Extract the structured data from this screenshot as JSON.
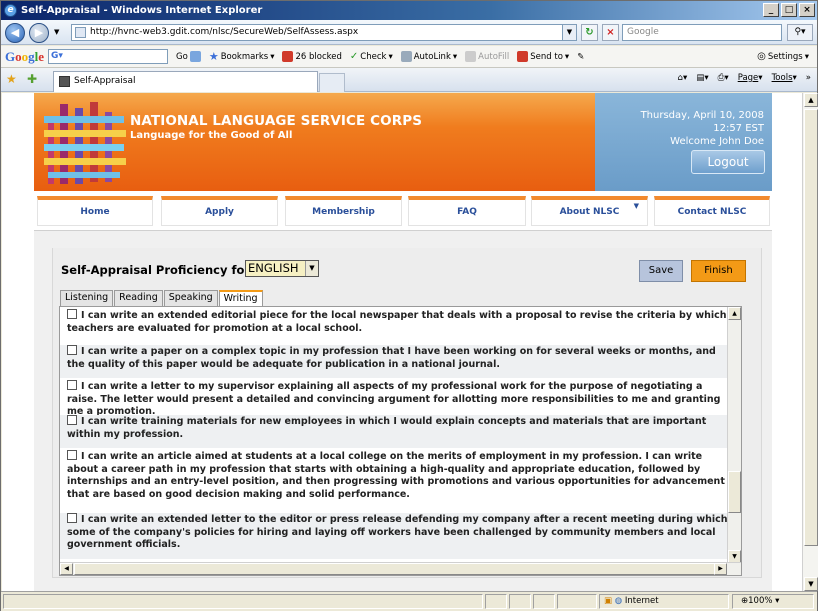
{
  "browser": {
    "title": "Self-Appraisal - Windows Internet Explorer",
    "url": "http://hvnc-web3.gdit.com/nlsc/SecureWeb/SelfAssess.aspx",
    "search_placeholder": "Google",
    "tab_title": "Self-Appraisal",
    "google_toolbar": {
      "go": "Go",
      "bookmarks": "Bookmarks",
      "blocked": "26 blocked",
      "check": "Check",
      "autolink": "AutoLink",
      "autofill": "AutoFill",
      "sendto": "Send to",
      "settings": "Settings"
    },
    "commands": {
      "page": "Page",
      "tools": "Tools"
    },
    "status": {
      "zone": "Internet",
      "zoom": "100%"
    }
  },
  "site": {
    "org_name": "NATIONAL LANGUAGE SERVICE CORPS",
    "tagline": "Language for the Good of All",
    "date": "Thursday, April 10, 2008",
    "time": "12:57 EST",
    "welcome": "Welcome John Doe",
    "logout": "Logout",
    "nav": [
      "Home",
      "Apply",
      "Membership",
      "FAQ",
      "About NLSC",
      "Contact NLSC"
    ]
  },
  "form": {
    "title": "Self-Appraisal Proficiency for:",
    "language": "ENGLISH",
    "save": "Save",
    "finish": "Finish",
    "tabs": [
      "Listening",
      "Reading",
      "Speaking",
      "Writing"
    ],
    "active_tab": "Writing",
    "items": [
      "I can write an extended editorial piece for the local newspaper that deals with a proposal to revise the criteria by which teachers are evaluated for promotion at a local school.",
      "I can write a paper on a complex topic in my profession that I have been working on for several weeks or months, and the quality of this paper would be adequate for publication in a national journal.",
      "I can write a letter to my supervisor explaining all aspects of my professional work for the purpose of negotiating a raise. The letter would present a detailed and convincing argument for allotting more responsibilities to me and granting me a promotion.",
      "I can write training materials for new employees in which I would explain concepts and materials that are important within my profession.",
      "I can write an article aimed at students at a local college on the merits of employment in my profession. I can write about a career path in my profession that starts with obtaining a high-quality and appropriate education, followed by internships and an entry-level position, and then progressing with promotions and various opportunities for advancement that are based on good decision making and solid performance.",
      "I can write an extended letter to the editor or press release defending my company after a recent meeting during which some of the company's policies for hiring and laying off workers have been challenged by community members and local government officials."
    ]
  }
}
